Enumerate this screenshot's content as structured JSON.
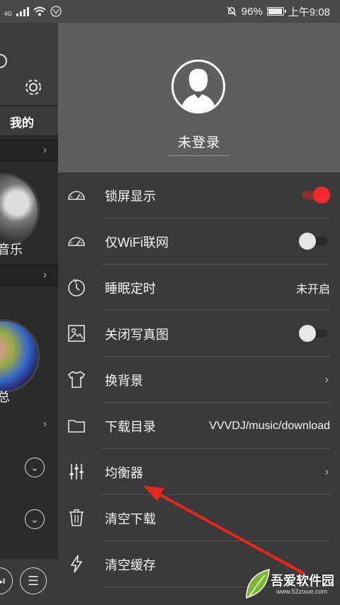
{
  "status_bar": {
    "network": "4G",
    "battery_percent": "96%",
    "time": "上午9:08",
    "battery_level": 0.96
  },
  "background_app": {
    "tab_label": "我的",
    "item1_text": "音乐",
    "item2_text": "总"
  },
  "drawer": {
    "profile": {
      "login_label": "未登录"
    },
    "items": [
      {
        "label": "锁屏显示",
        "control": "toggle",
        "on": true,
        "icon": "gauge-icon"
      },
      {
        "label": "仅WiFi联网",
        "control": "toggle",
        "on": false,
        "icon": "gauge-icon"
      },
      {
        "label": "睡眠定时",
        "control": "value",
        "value": "未开启",
        "icon": "timer-icon"
      },
      {
        "label": "关闭写真图",
        "control": "toggle",
        "on": false,
        "icon": "picture-icon"
      },
      {
        "label": "换背景",
        "control": "chevron",
        "icon": "tshirt-icon"
      },
      {
        "label": "下载目录",
        "control": "value",
        "value": "VVVDJ/music/download",
        "icon": "folder-icon"
      },
      {
        "label": "均衡器",
        "control": "chevron",
        "icon": "equalizer-icon"
      },
      {
        "label": "清空下载",
        "control": "none",
        "icon": "trash-icon"
      },
      {
        "label": "清空缓存",
        "control": "none",
        "icon": "lightning-icon"
      }
    ]
  },
  "watermark": {
    "text": "吾爱软件园",
    "url": "www.52zixue.com"
  },
  "colors": {
    "drawer_bg": "#3a3a3a",
    "profile_bg": "#5e5e5e",
    "toggle_on": "#ef2b2b",
    "arrow": "#e8261c"
  }
}
